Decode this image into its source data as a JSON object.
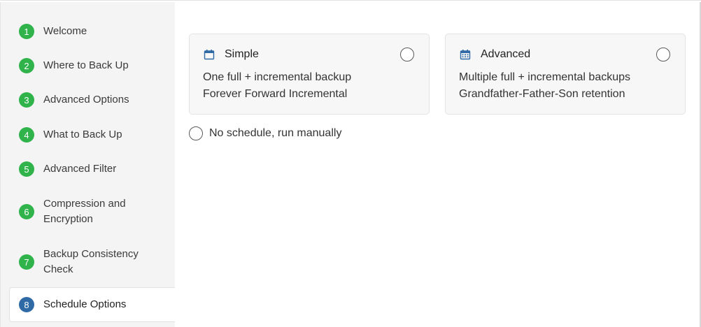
{
  "sidebar": {
    "steps": [
      {
        "number": "1",
        "label": "Welcome"
      },
      {
        "number": "2",
        "label": "Where to Back Up"
      },
      {
        "number": "3",
        "label": "Advanced Options"
      },
      {
        "number": "4",
        "label": "What to Back Up"
      },
      {
        "number": "5",
        "label": "Advanced Filter"
      },
      {
        "number": "6",
        "label_line1": "Compression and",
        "label_line2": "Encryption"
      },
      {
        "number": "7",
        "label_line1": "Backup Consistency",
        "label_line2": "Check"
      },
      {
        "number": "8",
        "label": "Schedule Options",
        "active": true
      }
    ],
    "colors": {
      "completed": "#2fb34a",
      "active": "#2f6aa6"
    }
  },
  "schedule": {
    "simple": {
      "icon": "calendar-icon",
      "title": "Simple",
      "line1": "One full + incremental backup",
      "line2": "Forever Forward Incremental",
      "selected": false
    },
    "advanced": {
      "icon": "calendar-grid-icon",
      "title": "Advanced",
      "line1": "Multiple full + incremental backups",
      "line2": "Grandfather-Father-Son retention",
      "selected": false
    },
    "manual": {
      "label": "No schedule, run manually",
      "selected": false
    }
  }
}
